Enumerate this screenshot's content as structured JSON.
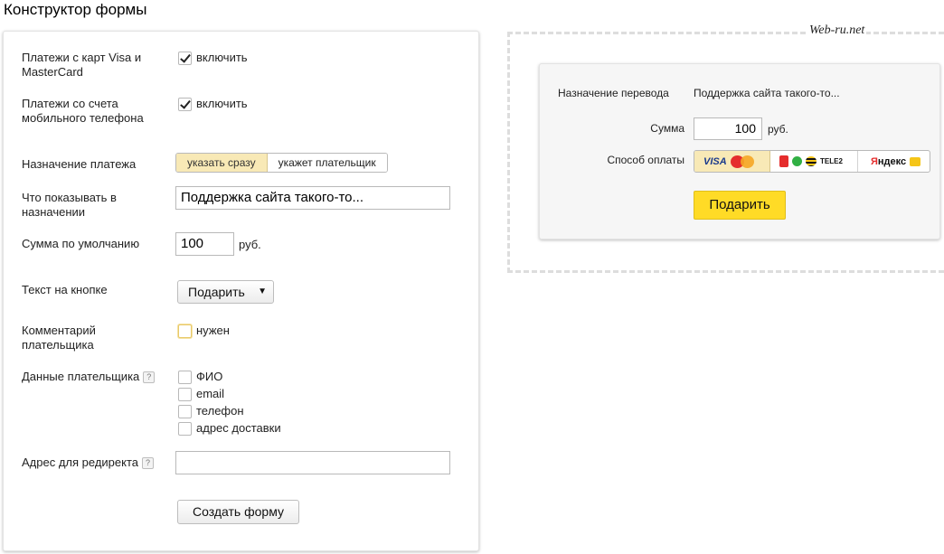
{
  "page": {
    "title": "Конструктор формы"
  },
  "form": {
    "card_payments": {
      "label": "Платежи с карт Visa и MasterCard",
      "checkbox_label": "включить",
      "checked": true
    },
    "mobile_payments": {
      "label": "Платежи со счета мобильного телефона",
      "checkbox_label": "включить",
      "checked": true
    },
    "purpose_mode": {
      "label": "Назначение платежа",
      "options": [
        "указать сразу",
        "укажет плательщик"
      ],
      "selected": "указать сразу"
    },
    "purpose_text": {
      "label": "Что показывать в назначении",
      "value": "Поддержка сайта такого-то..."
    },
    "default_sum": {
      "label": "Сумма по умолчанию",
      "value": "100",
      "unit": "руб."
    },
    "button_text": {
      "label": "Текст на кнопке",
      "value": "Подарить"
    },
    "comment": {
      "label": "Комментарий плательщика",
      "checkbox_label": "нужен",
      "checked": false
    },
    "payer_data": {
      "label": "Данные плательщика",
      "help": "?",
      "options": [
        "ФИО",
        "email",
        "телефон",
        "адрес доставки"
      ]
    },
    "redirect": {
      "label": "Адрес для редиректа",
      "help": "?",
      "value": ""
    },
    "submit_label": "Создать форму"
  },
  "preview": {
    "watermark": "Web-ru.net",
    "purpose_label": "Назначение перевода",
    "purpose_value": "Поддержка сайта такого-то...",
    "sum_label": "Сумма",
    "sum_value": "100",
    "sum_unit": "руб.",
    "method_label": "Способ оплаты",
    "methods": {
      "card": "VISA",
      "tele2": "TELE2",
      "wallet_ya": "Я",
      "wallet_rest": "ндекс"
    },
    "button_label": "Подарить",
    "colors": {
      "accent_button": "#ffdb26",
      "selected_tab": "#f8e9b6"
    }
  }
}
